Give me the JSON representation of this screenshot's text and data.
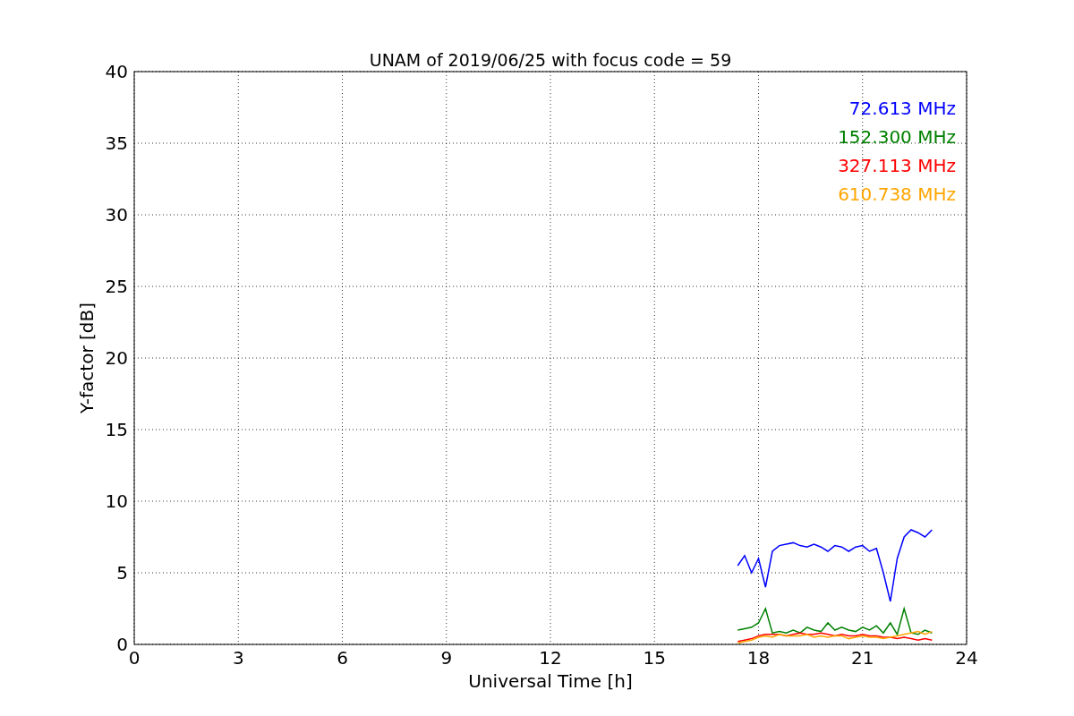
{
  "chart_data": {
    "type": "line",
    "title": "UNAM of 2019/06/25 with focus code = 59",
    "xlabel": "Universal Time [h]",
    "ylabel": "Y-factor [dB]",
    "x": [
      17.4,
      17.6,
      17.8,
      18.0,
      18.2,
      18.4,
      18.6,
      18.8,
      19.0,
      19.2,
      19.4,
      19.6,
      19.8,
      20.0,
      20.2,
      20.4,
      20.6,
      20.8,
      21.0,
      21.2,
      21.4,
      21.6,
      21.8,
      22.0,
      22.2,
      22.4,
      22.6,
      22.8,
      23.0
    ],
    "series": [
      {
        "name": "72.613 MHz",
        "color": "#0000ff",
        "values": [
          5.5,
          6.2,
          5.0,
          6.0,
          4.0,
          6.5,
          6.9,
          7.0,
          7.1,
          6.9,
          6.8,
          7.0,
          6.8,
          6.5,
          6.9,
          6.8,
          6.5,
          6.8,
          6.9,
          6.5,
          6.7,
          5.0,
          3.0,
          6.0,
          7.5,
          8.0,
          7.8,
          7.5,
          8.0
        ]
      },
      {
        "name": "152.300 MHz",
        "color": "#008000",
        "values": [
          1.0,
          1.1,
          1.2,
          1.5,
          2.5,
          0.8,
          0.9,
          0.8,
          1.0,
          0.8,
          1.2,
          1.0,
          0.9,
          1.5,
          1.0,
          1.2,
          1.0,
          0.9,
          1.2,
          1.0,
          1.3,
          0.8,
          1.5,
          0.7,
          2.5,
          0.8,
          0.7,
          1.0,
          0.8
        ]
      },
      {
        "name": "327.113 MHz",
        "color": "#ff0000",
        "values": [
          0.2,
          0.3,
          0.4,
          0.6,
          0.7,
          0.7,
          0.7,
          0.6,
          0.7,
          0.8,
          0.7,
          0.7,
          0.8,
          0.7,
          0.6,
          0.7,
          0.6,
          0.6,
          0.7,
          0.6,
          0.6,
          0.5,
          0.5,
          0.4,
          0.5,
          0.4,
          0.3,
          0.4,
          0.3
        ]
      },
      {
        "name": "610.738 MHz",
        "color": "#ffa500",
        "values": [
          0.1,
          0.2,
          0.3,
          0.5,
          0.6,
          0.5,
          0.7,
          0.6,
          0.6,
          0.6,
          0.7,
          0.5,
          0.6,
          0.5,
          0.6,
          0.6,
          0.4,
          0.5,
          0.6,
          0.5,
          0.5,
          0.4,
          0.5,
          0.6,
          0.7,
          0.8,
          0.9,
          0.7,
          0.9
        ]
      }
    ],
    "xlim": [
      0,
      24
    ],
    "ylim": [
      0,
      40
    ],
    "xticks": [
      0,
      3,
      6,
      9,
      12,
      15,
      18,
      21,
      24
    ],
    "yticks": [
      0,
      5,
      10,
      15,
      20,
      25,
      30,
      35,
      40
    ],
    "grid": true
  }
}
